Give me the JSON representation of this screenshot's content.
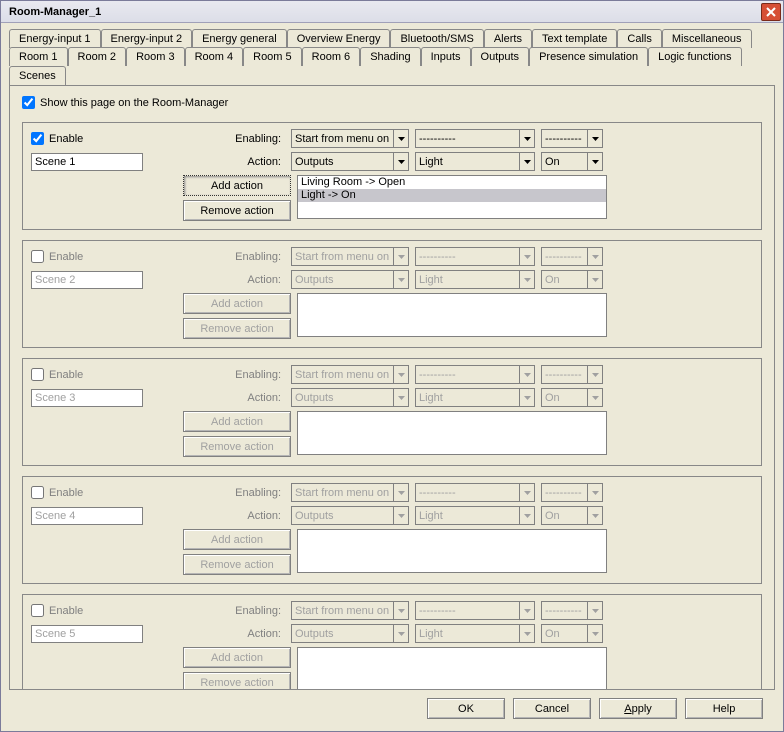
{
  "window": {
    "title": "Room-Manager_1"
  },
  "tabs_row1": [
    "Energy-input 1",
    "Energy-input 2",
    "Energy general",
    "Overview Energy",
    "Bluetooth/SMS",
    "Alerts",
    "Text template",
    "Calls",
    "Miscellaneous"
  ],
  "tabs_row2": [
    "Room 1",
    "Room 2",
    "Room 3",
    "Room 4",
    "Room 5",
    "Room 6",
    "Shading",
    "Inputs",
    "Outputs",
    "Presence simulation",
    "Logic functions",
    "Scenes"
  ],
  "active_tab": "Scenes",
  "show_page_label": "Show this page on the Room-Manager",
  "labels": {
    "enable": "Enable",
    "enabling": "Enabling:",
    "action": "Action:",
    "add_action": "Add action",
    "remove_action": "Remove action",
    "placeholder": "----------"
  },
  "scenes": [
    {
      "enabled": true,
      "name": "Scene 1",
      "enabling_sel": [
        "Start from menu on",
        "----------",
        "----------"
      ],
      "action_sel": [
        "Outputs",
        "Light",
        "On"
      ],
      "actions": [
        "Living Room -> Open",
        "Light -> On"
      ],
      "sel_index": 1,
      "add_pressed": true
    },
    {
      "enabled": false,
      "name": "Scene 2",
      "enabling_sel": [
        "Start from menu on",
        "----------",
        "----------"
      ],
      "action_sel": [
        "Outputs",
        "Light",
        "On"
      ],
      "actions": []
    },
    {
      "enabled": false,
      "name": "Scene 3",
      "enabling_sel": [
        "Start from menu on",
        "----------",
        "----------"
      ],
      "action_sel": [
        "Outputs",
        "Light",
        "On"
      ],
      "actions": []
    },
    {
      "enabled": false,
      "name": "Scene 4",
      "enabling_sel": [
        "Start from menu on",
        "----------",
        "----------"
      ],
      "action_sel": [
        "Outputs",
        "Light",
        "On"
      ],
      "actions": []
    },
    {
      "enabled": false,
      "name": "Scene 5",
      "enabling_sel": [
        "Start from menu on",
        "----------",
        "----------"
      ],
      "action_sel": [
        "Outputs",
        "Light",
        "On"
      ],
      "actions": []
    }
  ],
  "buttons": {
    "ok": "OK",
    "cancel": "Cancel",
    "apply": "Apply",
    "help": "Help"
  }
}
